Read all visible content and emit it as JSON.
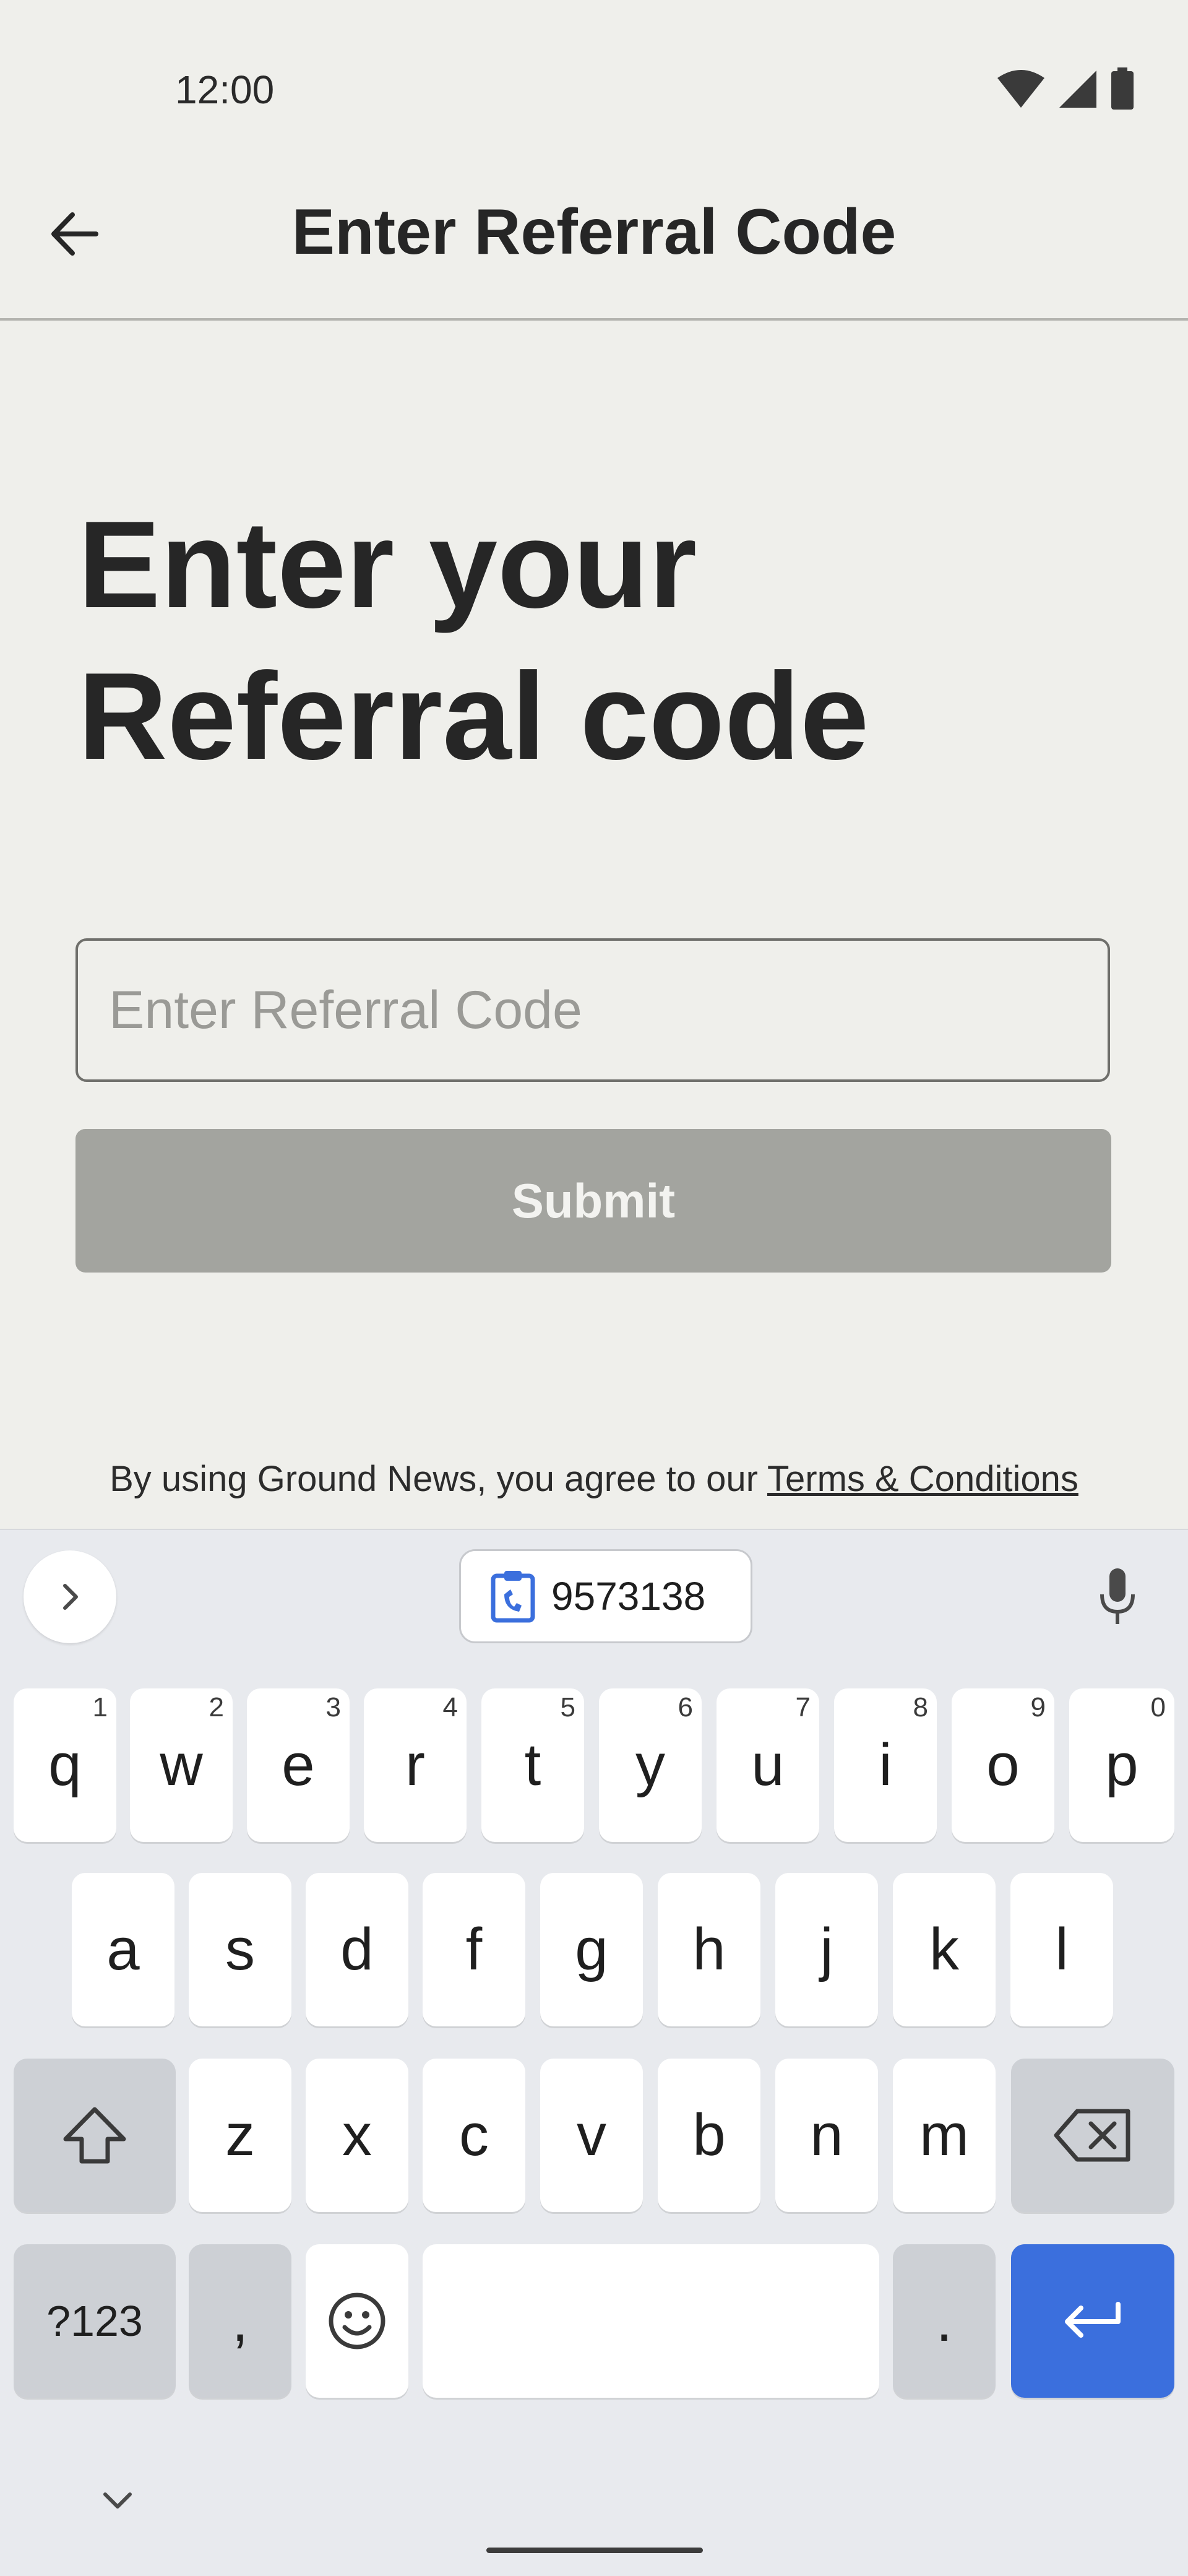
{
  "status_bar": {
    "time": "12:00"
  },
  "app_bar": {
    "title": "Enter Referral Code"
  },
  "main": {
    "heading_line1": "Enter your",
    "heading_line2": "Referral code",
    "input_placeholder": "Enter Referral Code",
    "input_value": "",
    "submit_label": "Submit",
    "terms_prefix": "By using Ground News, you agree to our ",
    "terms_link": "Terms & Conditions"
  },
  "keyboard": {
    "clipboard_text": "9573138",
    "row1": [
      {
        "label": "q",
        "hint": "1"
      },
      {
        "label": "w",
        "hint": "2"
      },
      {
        "label": "e",
        "hint": "3"
      },
      {
        "label": "r",
        "hint": "4"
      },
      {
        "label": "t",
        "hint": "5"
      },
      {
        "label": "y",
        "hint": "6"
      },
      {
        "label": "u",
        "hint": "7"
      },
      {
        "label": "i",
        "hint": "8"
      },
      {
        "label": "o",
        "hint": "9"
      },
      {
        "label": "p",
        "hint": "0"
      }
    ],
    "row2": [
      "a",
      "s",
      "d",
      "f",
      "g",
      "h",
      "j",
      "k",
      "l"
    ],
    "row3": [
      "z",
      "x",
      "c",
      "v",
      "b",
      "n",
      "m"
    ],
    "symbols_label": "?123",
    "comma_label": ",",
    "period_label": "."
  },
  "colors": {
    "background": "#efefeb",
    "submit_disabled": "#a3a49f",
    "enter_key": "#3b6fdd",
    "keyboard_bg": "#e8eaee"
  },
  "icons": [
    "back-arrow-icon",
    "wifi-icon",
    "signal-icon",
    "battery-icon",
    "chevron-right-icon",
    "clipboard-icon",
    "microphone-icon",
    "shift-icon",
    "backspace-icon",
    "emoji-icon",
    "enter-icon",
    "chevron-down-icon"
  ]
}
